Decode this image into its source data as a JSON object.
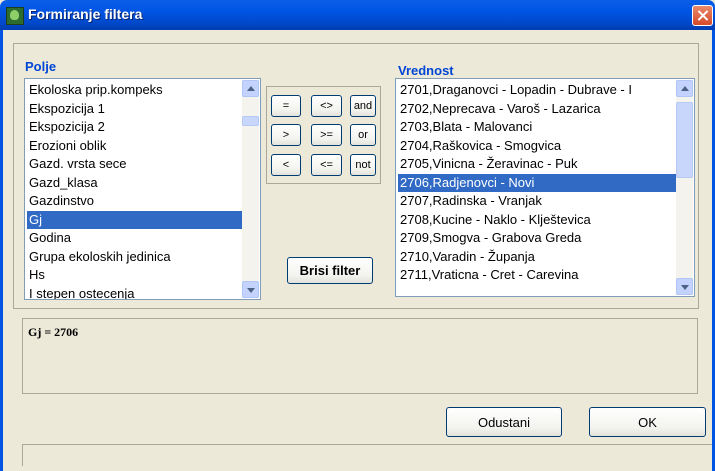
{
  "window": {
    "title": "Formiranje filtera"
  },
  "polje": {
    "label": "Polje",
    "items": [
      "Ekoloska prip.kompeks",
      "Ekspozicija 1",
      "Ekspozicija 2",
      "Erozioni oblik",
      "Gazd. vrsta sece",
      "Gazd_klasa",
      "Gazdinstvo",
      "Gj",
      "Godina",
      "Grupa ekoloskih jedinica",
      "Hs",
      "I  stepen ostecenja"
    ],
    "selected": "Gj"
  },
  "vrednost": {
    "label": "Vrednost",
    "items": [
      "2701,Draganovci - Lopadin - Dubrave - I",
      "2702,Neprecava - Varoš - Lazarica",
      "2703,Blata - Malovanci",
      "2704,Raškovica - Smogvica",
      "2705,Vinicna - Žeravinac - Puk",
      "2706,Radjenovci - Novi",
      "2707,Radinska - Vranjak",
      "2708,Kucine - Naklo - Klještevica",
      "2709,Smogva - Grabova Greda",
      "2710,Varadin - Županja",
      "2711,Vraticna - Cret - Carevina"
    ],
    "selected": "2706,Radjenovci - Novi"
  },
  "operators": [
    "=",
    "<>",
    "and",
    ">",
    ">=",
    "or",
    "<",
    "<=",
    "not"
  ],
  "buttons": {
    "brisi_filter": "Brisi  filter",
    "odustani": "Odustani",
    "ok": "OK"
  },
  "expression": "Gj = 2706"
}
